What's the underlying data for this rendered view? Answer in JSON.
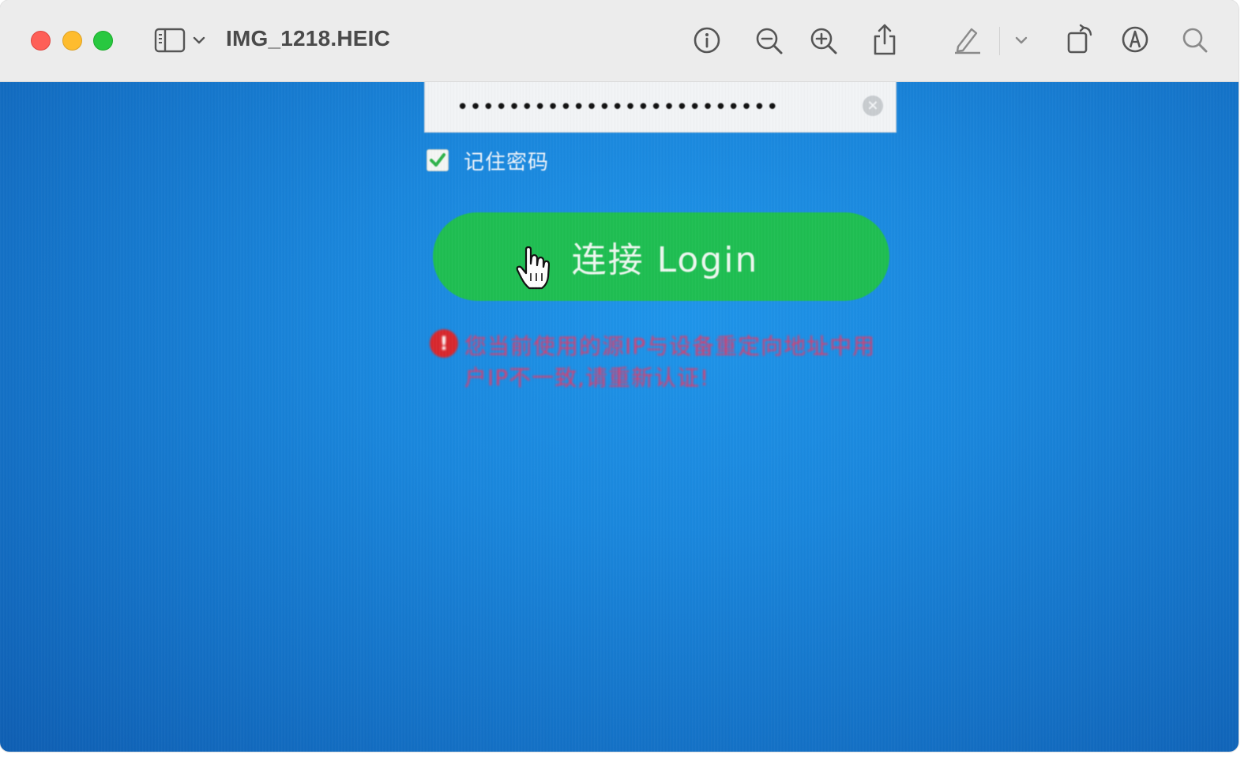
{
  "window": {
    "title": "IMG_1218.HEIC"
  },
  "toolbar": {
    "icons": [
      "sidebar-icon",
      "chevron-down-icon",
      "info-icon",
      "zoom-out-icon",
      "zoom-in-icon",
      "share-icon",
      "markup-pen-icon",
      "chevron-down-icon",
      "rotate-icon",
      "annotate-icon",
      "search-icon"
    ]
  },
  "login_form": {
    "password_mask": "•••••••••••••••••••••••••",
    "clear_symbol": "×",
    "remember_label": "记住密码",
    "remember_checked": true,
    "login_button_label": "连接 Login",
    "error_icon_symbol": "!",
    "error_message": "您当前使用的源IP与设备重定向地址中用户IP不一致,请重新认证!"
  },
  "colors": {
    "background_blue": "#1a87dd",
    "button_green": "#1fbe52",
    "error_red": "#e23a6a"
  }
}
